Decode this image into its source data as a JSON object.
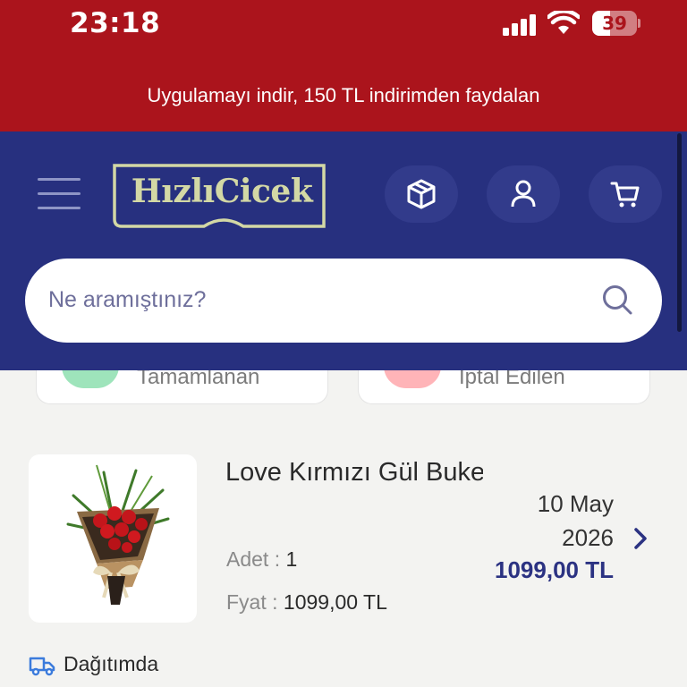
{
  "status_bar": {
    "time": "23:18",
    "battery": "39",
    "battery_level": 0.39
  },
  "promo": {
    "text": "Uygulamayı indir, 150 TL indirimden faydalan"
  },
  "header": {
    "logo_text": "HızlıCicek",
    "icons": [
      "menu-icon",
      "package-icon",
      "user-icon",
      "cart-icon"
    ],
    "colors": {
      "brand_red": "#ab141c",
      "brand_navy": "#27307f",
      "logo": "#d3d8a5"
    }
  },
  "search": {
    "placeholder": "Ne aramıştınız?"
  },
  "filters": [
    {
      "label": "Tamamlanan",
      "dot_color": "#9ee4bb"
    },
    {
      "label": "İptal Edilen",
      "dot_color": "#ffb4b8"
    }
  ],
  "order": {
    "product_name": "Love Kırmızı Gül Buketi",
    "date": "10 May 2026",
    "price": "1099,00 TL",
    "qty_label": "Adet :",
    "qty_value": "1",
    "unit_price_label": "Fyat :",
    "unit_price_value": "1099,00 TL",
    "status": "Dağıtımda"
  }
}
